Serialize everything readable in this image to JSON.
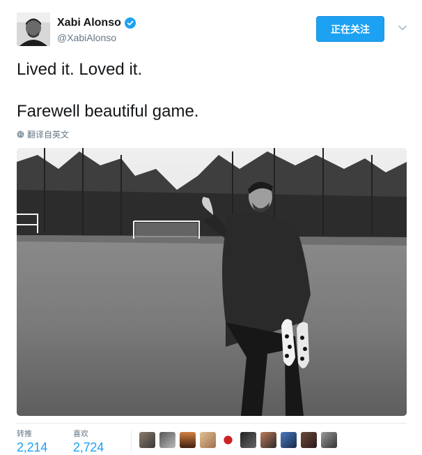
{
  "author": {
    "display_name": "Xabi Alonso",
    "handle": "@XabiAlonso",
    "verified_icon": "verified-badge-icon",
    "avatar_icon": "profile-photo"
  },
  "follow_button": {
    "label": "正在关注"
  },
  "caret_icon": "chevron-down-icon",
  "tweet": {
    "line1": "Lived it. Loved it.",
    "line2": "Farewell beautiful game."
  },
  "translate": {
    "label": "翻译自英文",
    "icon": "globe-icon"
  },
  "photo": {
    "alt": ""
  },
  "stats": {
    "retweets_label": "转推",
    "retweets_value": "2,214",
    "likes_label": "喜欢",
    "likes_value": "2,724"
  },
  "liker_count": 10,
  "colors": {
    "accent": "#1da1f2",
    "text": "#14171a",
    "muted": "#657786",
    "divider": "#e6ecf0"
  }
}
